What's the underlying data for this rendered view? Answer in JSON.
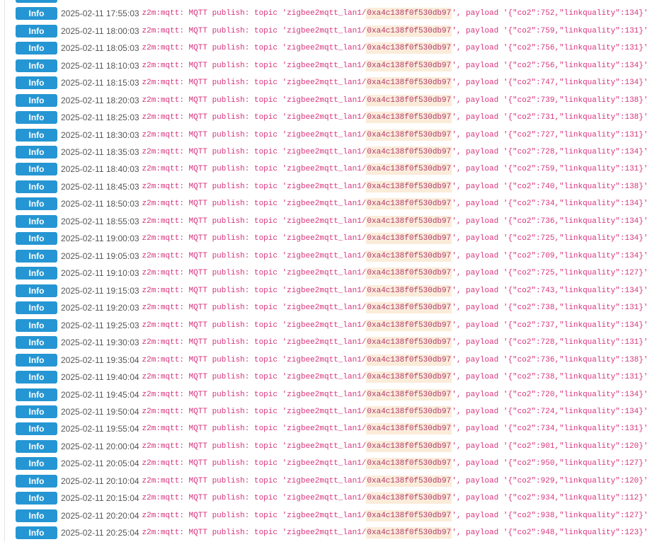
{
  "level_label": "Info",
  "message_prefix": "z2m:mqtt: MQTT publish: topic 'zigbee2mqtt_lan1/",
  "device_id": "0xa4c138f0f530db97",
  "payload_prefix": "', payload '",
  "entries": [
    {
      "time": "2025-02-11 17:55:03",
      "payload": "{\"co2\":752,\"linkquality\":134}'"
    },
    {
      "time": "2025-02-11 18:00:03",
      "payload": "{\"co2\":759,\"linkquality\":131}'"
    },
    {
      "time": "2025-02-11 18:05:03",
      "payload": "{\"co2\":756,\"linkquality\":131}'"
    },
    {
      "time": "2025-02-11 18:10:03",
      "payload": "{\"co2\":756,\"linkquality\":134}'"
    },
    {
      "time": "2025-02-11 18:15:03",
      "payload": "{\"co2\":747,\"linkquality\":134}'"
    },
    {
      "time": "2025-02-11 18:20:03",
      "payload": "{\"co2\":739,\"linkquality\":138}'"
    },
    {
      "time": "2025-02-11 18:25:03",
      "payload": "{\"co2\":731,\"linkquality\":138}'"
    },
    {
      "time": "2025-02-11 18:30:03",
      "payload": "{\"co2\":727,\"linkquality\":131}'"
    },
    {
      "time": "2025-02-11 18:35:03",
      "payload": "{\"co2\":728,\"linkquality\":134}'"
    },
    {
      "time": "2025-02-11 18:40:03",
      "payload": "{\"co2\":759,\"linkquality\":131}'"
    },
    {
      "time": "2025-02-11 18:45:03",
      "payload": "{\"co2\":740,\"linkquality\":138}'"
    },
    {
      "time": "2025-02-11 18:50:03",
      "payload": "{\"co2\":734,\"linkquality\":134}'"
    },
    {
      "time": "2025-02-11 18:55:03",
      "payload": "{\"co2\":736,\"linkquality\":134}'"
    },
    {
      "time": "2025-02-11 19:00:03",
      "payload": "{\"co2\":725,\"linkquality\":134}'"
    },
    {
      "time": "2025-02-11 19:05:03",
      "payload": "{\"co2\":709,\"linkquality\":134}'"
    },
    {
      "time": "2025-02-11 19:10:03",
      "payload": "{\"co2\":725,\"linkquality\":127}'"
    },
    {
      "time": "2025-02-11 19:15:03",
      "payload": "{\"co2\":743,\"linkquality\":134}'"
    },
    {
      "time": "2025-02-11 19:20:03",
      "payload": "{\"co2\":738,\"linkquality\":131}'"
    },
    {
      "time": "2025-02-11 19:25:03",
      "payload": "{\"co2\":737,\"linkquality\":134}'"
    },
    {
      "time": "2025-02-11 19:30:03",
      "payload": "{\"co2\":728,\"linkquality\":131}'"
    },
    {
      "time": "2025-02-11 19:35:04",
      "payload": "{\"co2\":736,\"linkquality\":138}'"
    },
    {
      "time": "2025-02-11 19:40:04",
      "payload": "{\"co2\":738,\"linkquality\":131}'"
    },
    {
      "time": "2025-02-11 19:45:04",
      "payload": "{\"co2\":720,\"linkquality\":134}'"
    },
    {
      "time": "2025-02-11 19:50:04",
      "payload": "{\"co2\":724,\"linkquality\":134}'"
    },
    {
      "time": "2025-02-11 19:55:04",
      "payload": "{\"co2\":734,\"linkquality\":131}'"
    },
    {
      "time": "2025-02-11 20:00:04",
      "payload": "{\"co2\":901,\"linkquality\":120}'"
    },
    {
      "time": "2025-02-11 20:05:04",
      "payload": "{\"co2\":950,\"linkquality\":127}'"
    },
    {
      "time": "2025-02-11 20:10:04",
      "payload": "{\"co2\":929,\"linkquality\":120}'"
    },
    {
      "time": "2025-02-11 20:15:04",
      "payload": "{\"co2\":934,\"linkquality\":112}'"
    },
    {
      "time": "2025-02-11 20:20:04",
      "payload": "{\"co2\":938,\"linkquality\":127}'"
    },
    {
      "time": "2025-02-11 20:25:04",
      "payload": "{\"co2\":948,\"linkquality\":123}'"
    }
  ],
  "colors": {
    "badge": "#2596d3",
    "message": "#d6337d",
    "device_highlight": "#fbecd9",
    "timestamp": "#555555"
  }
}
